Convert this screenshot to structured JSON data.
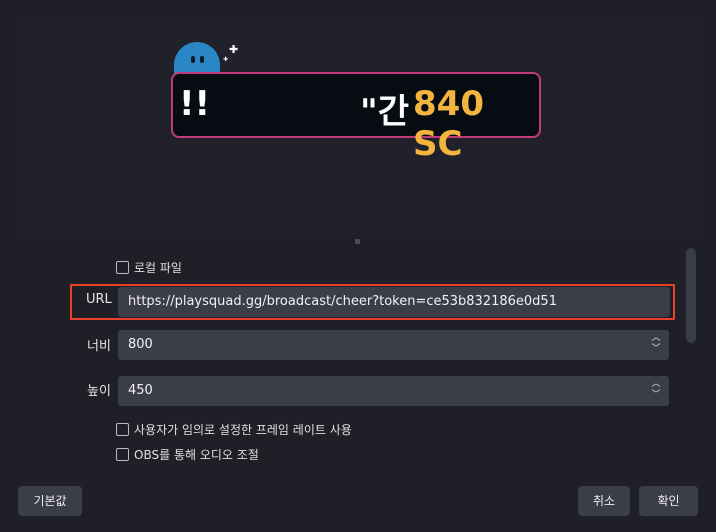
{
  "preview": {
    "banner_prefix": "\"간",
    "banner_bang": "!!",
    "banner_amount": "840 SC"
  },
  "options": {
    "local_file_label": "로컬 파일",
    "custom_framerate_label": "사용자가 임의로 설정한 프레임 레이트 사용",
    "obs_audio_label": "OBS를 통해 오디오 조절"
  },
  "fields": {
    "url_label": "URL",
    "url_value": "https://playsquad.gg/broadcast/cheer?token=ce53b832186e0d51",
    "width_label": "너비",
    "width_value": "800",
    "height_label": "높이",
    "height_value": "450"
  },
  "buttons": {
    "defaults": "기본값",
    "cancel": "취소",
    "ok": "확인"
  },
  "colors": {
    "accent_highlight": "#e8402a",
    "banner_border": "#c23a7e",
    "banner_amount": "#f4b53f"
  }
}
